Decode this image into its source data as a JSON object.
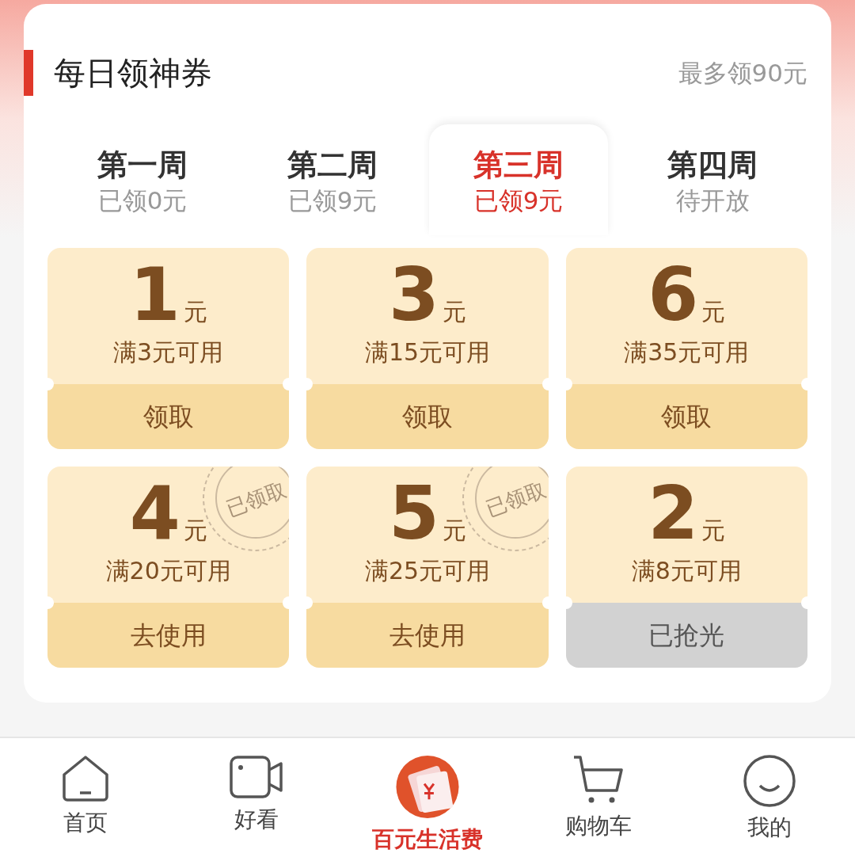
{
  "header": {
    "title": "每日领神券",
    "note": "最多领90元"
  },
  "weeks": [
    {
      "label": "第一周",
      "status": "已领0元",
      "selected": false
    },
    {
      "label": "第二周",
      "status": "已领9元",
      "selected": false
    },
    {
      "label": "第三周",
      "status": "已领9元",
      "selected": true
    },
    {
      "label": "第四周",
      "status": "待开放",
      "selected": false
    }
  ],
  "coupons": [
    {
      "amount": "1",
      "unit": "元",
      "condition": "满3元可用",
      "action": "领取",
      "kind": "available"
    },
    {
      "amount": "3",
      "unit": "元",
      "condition": "满15元可用",
      "action": "领取",
      "kind": "available"
    },
    {
      "amount": "6",
      "unit": "元",
      "condition": "满35元可用",
      "action": "领取",
      "kind": "available"
    },
    {
      "amount": "4",
      "unit": "元",
      "condition": "满20元可用",
      "action": "去使用",
      "kind": "claimed",
      "stamp": "已领取"
    },
    {
      "amount": "5",
      "unit": "元",
      "condition": "满25元可用",
      "action": "去使用",
      "kind": "claimed",
      "stamp": "已领取"
    },
    {
      "amount": "2",
      "unit": "元",
      "condition": "满8元可用",
      "action": "已抢光",
      "kind": "soldout"
    }
  ],
  "tabbar": [
    {
      "label": "首页",
      "selected": false
    },
    {
      "label": "好看",
      "selected": false
    },
    {
      "label": "百元生活费",
      "selected": true
    },
    {
      "label": "购物车",
      "selected": false
    },
    {
      "label": "我的",
      "selected": false
    }
  ]
}
